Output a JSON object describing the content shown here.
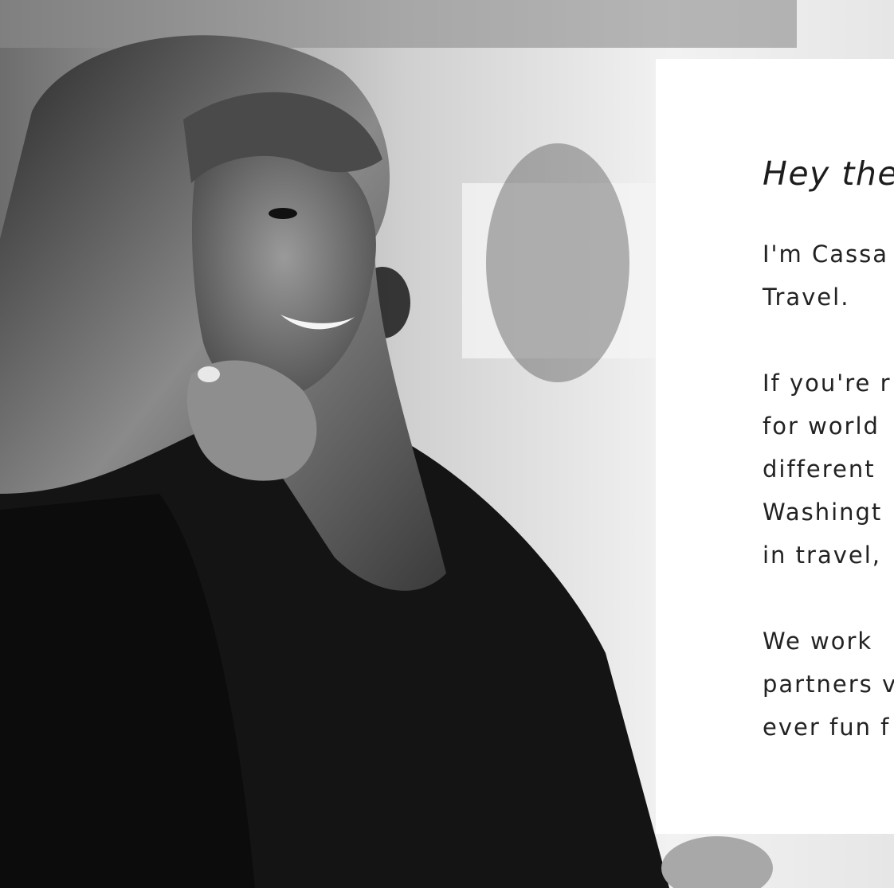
{
  "hero": {
    "photo_alt": "Black and white portrait of smiling woman",
    "greeting": "Hey the",
    "paragraphs": [
      {
        "lines": [
          "I'm Cassa",
          "Travel."
        ]
      },
      {
        "lines": [
          "If you're r",
          "for world",
          "different",
          "Washingt",
          "in travel,"
        ]
      },
      {
        "lines": [
          "We work",
          "partners v",
          "ever fun f"
        ]
      }
    ]
  }
}
